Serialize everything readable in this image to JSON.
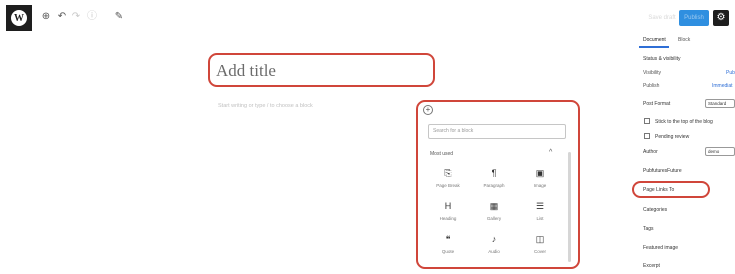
{
  "toolbar": {
    "logo": "W",
    "icons": [
      "add-block-icon",
      "undo-icon",
      "redo-icon",
      "info-icon",
      "edit-icon"
    ],
    "save_draft_label": "Save draft",
    "publish_label": "Publish",
    "settings_icon": "gear-icon"
  },
  "editor": {
    "title_placeholder": "Add title",
    "block_placeholder": "Start writing or type / to choose a block"
  },
  "inserter": {
    "search_placeholder": "Search for a block",
    "section_label": "Most used",
    "blocks": [
      {
        "label": "Page Break",
        "icon": "page-break-icon",
        "glyph": "⎘"
      },
      {
        "label": "Paragraph",
        "icon": "paragraph-icon",
        "glyph": "¶"
      },
      {
        "label": "Image",
        "icon": "image-icon",
        "glyph": "▣"
      },
      {
        "label": "Heading",
        "icon": "heading-icon",
        "glyph": "H"
      },
      {
        "label": "Gallery",
        "icon": "gallery-icon",
        "glyph": "▦"
      },
      {
        "label": "List",
        "icon": "list-icon",
        "glyph": "☰"
      },
      {
        "label": "Quote",
        "icon": "quote-icon",
        "glyph": "❝"
      },
      {
        "label": "Audio",
        "icon": "audio-icon",
        "glyph": "♪"
      },
      {
        "label": "Cover",
        "icon": "cover-icon",
        "glyph": "◫"
      }
    ]
  },
  "sidebar": {
    "tabs": [
      "Document",
      "Block"
    ],
    "status_heading": "Status & visibility",
    "visibility_label": "Visibility",
    "visibility_value": "Pub",
    "publish_label": "Publish",
    "publish_value": "Immediat",
    "post_format_label": "Post Format",
    "post_format_value": "Standard",
    "sticky_label": "Stick to the top of the blog",
    "pending_label": "Pending review",
    "author_label": "Author",
    "author_value": "demo",
    "pubfuture_label": "PubfuturesFuture",
    "page_links_label": "Page Links To",
    "categories_label": "Categories",
    "tags_label": "Tags",
    "featured_label": "Featured image",
    "excerpt_label": "Excerpt"
  }
}
